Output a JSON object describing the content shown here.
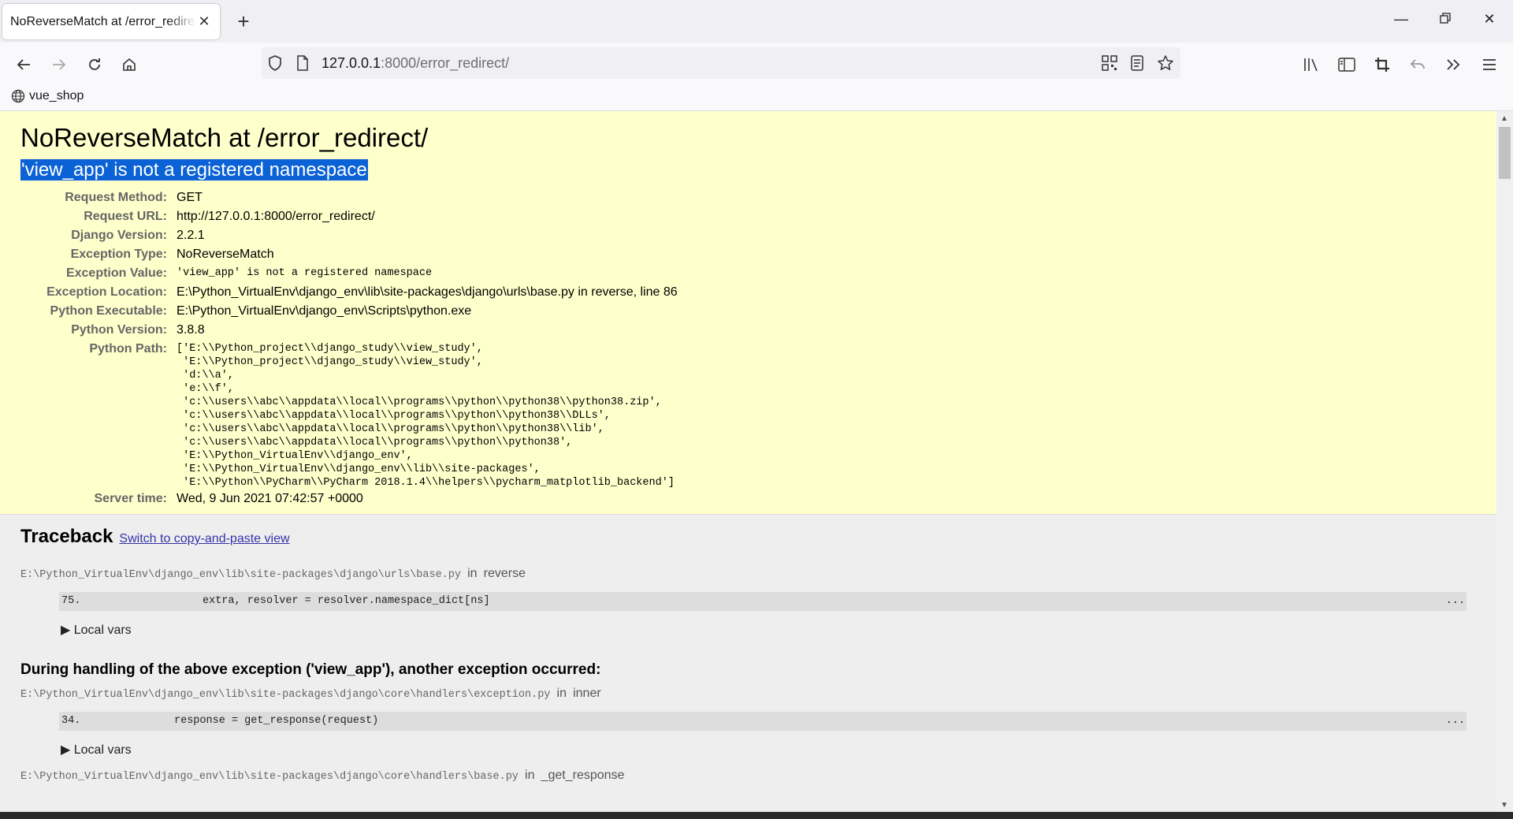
{
  "tab": {
    "title": "NoReverseMatch at /error_redirect/"
  },
  "urlbar": {
    "host": "127.0.0.1",
    "rest": ":8000/error_redirect/"
  },
  "bookmarks": [
    {
      "label": "vue_shop"
    }
  ],
  "page": {
    "title": "NoReverseMatch at /error_redirect/",
    "subtitle": "'view_app' is not a registered namespace",
    "meta": [
      {
        "key": "Request Method:",
        "value": "GET"
      },
      {
        "key": "Request URL:",
        "value": "http://127.0.0.1:8000/error_redirect/"
      },
      {
        "key": "Django Version:",
        "value": "2.2.1"
      },
      {
        "key": "Exception Type:",
        "value": "NoReverseMatch"
      },
      {
        "key": "Exception Value:",
        "value": "'view_app' is not a registered namespace"
      },
      {
        "key": "Exception Location:",
        "value": "E:\\Python_VirtualEnv\\django_env\\lib\\site-packages\\django\\urls\\base.py in reverse, line 86"
      },
      {
        "key": "Python Executable:",
        "value": "E:\\Python_VirtualEnv\\django_env\\Scripts\\python.exe"
      },
      {
        "key": "Python Version:",
        "value": "3.8.8"
      }
    ],
    "python_path_label": "Python Path:",
    "python_path": "['E:\\\\Python_project\\\\django_study\\\\view_study',\n 'E:\\\\Python_project\\\\django_study\\\\view_study',\n 'd:\\\\a',\n 'e:\\\\f',\n 'c:\\\\users\\\\abc\\\\appdata\\\\local\\\\programs\\\\python\\\\python38\\\\python38.zip',\n 'c:\\\\users\\\\abc\\\\appdata\\\\local\\\\programs\\\\python\\\\python38\\\\DLLs',\n 'c:\\\\users\\\\abc\\\\appdata\\\\local\\\\programs\\\\python\\\\python38\\\\lib',\n 'c:\\\\users\\\\abc\\\\appdata\\\\local\\\\programs\\\\python\\\\python38',\n 'E:\\\\Python_VirtualEnv\\\\django_env',\n 'E:\\\\Python_VirtualEnv\\\\django_env\\\\lib\\\\site-packages',\n 'E:\\\\Python\\\\PyCharm\\\\PyCharm 2018.1.4\\\\helpers\\\\pycharm_matplotlib_backend']",
    "server_time_label": "Server time:",
    "server_time": "Wed, 9 Jun 2021 07:42:57 +0000"
  },
  "traceback": {
    "heading": "Traceback",
    "switch_link": "Switch to copy-and-paste view",
    "frame1": {
      "file": "E:\\Python_VirtualEnv\\django_env\\lib\\site-packages\\django\\urls\\base.py",
      "in": "in",
      "func": "reverse",
      "lineno": "75.",
      "code": "extra, resolver = resolver.namespace_dict[ns]",
      "dots": "...",
      "localvars": "▶ Local vars"
    },
    "during": "During handling of the above exception ('view_app'), another exception occurred:",
    "frame2": {
      "file": "E:\\Python_VirtualEnv\\django_env\\lib\\site-packages\\django\\core\\handlers\\exception.py",
      "in": "in",
      "func": "inner",
      "lineno": "34.",
      "code": "response = get_response(request)",
      "dots": "...",
      "localvars": "▶ Local vars"
    },
    "frame3": {
      "file": "E:\\Python_VirtualEnv\\django_env\\lib\\site-packages\\django\\core\\handlers\\base.py",
      "in": "in",
      "func": "_get_response"
    }
  }
}
